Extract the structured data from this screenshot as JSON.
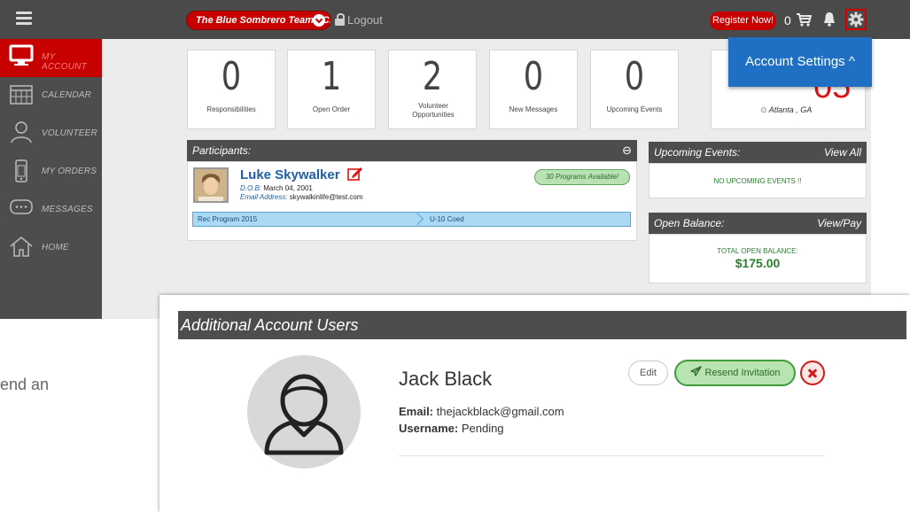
{
  "topbar": {
    "team_select": "The Blue Sombrero Team - C...",
    "logout": "Logout",
    "register": "Register Now!",
    "cart_count": "0",
    "account_settings": "Account Settings ^"
  },
  "sidebar": {
    "items": [
      {
        "label": "MY ACCOUNT",
        "icon": "monitor-icon",
        "active": true
      },
      {
        "label": "CALENDAR",
        "icon": "calendar-icon"
      },
      {
        "label": "VOLUNTEER",
        "icon": "person-icon"
      },
      {
        "label": "MY ORDERS",
        "icon": "phone-icon"
      },
      {
        "label": "MESSAGES",
        "icon": "chat-icon"
      },
      {
        "label": "HOME",
        "icon": "home-icon"
      }
    ]
  },
  "stats": [
    {
      "value": "0",
      "caption": "Responsibilities"
    },
    {
      "value": "1",
      "caption": "Open Order"
    },
    {
      "value": "2",
      "caption": "Volunteer Opportunities"
    },
    {
      "value": "0",
      "caption": "New Messages"
    },
    {
      "value": "0",
      "caption": "Upcoming Events"
    }
  ],
  "weather": {
    "temp_partial": "05",
    "location": "Atlanta , GA"
  },
  "participants": {
    "title": "Participants:",
    "name": "Luke Skywalker",
    "dob_label": "D.O.B:",
    "dob": "March 04, 2001",
    "email_label": "Email Address:",
    "email": "skywalkinlife@test.com",
    "programs_badge": "30 Programs Available!",
    "program": "Rec Program 2015",
    "division": "U-10 Coed"
  },
  "upcoming_events": {
    "title": "Upcoming Events:",
    "action": "View All",
    "empty": "NO UPCOMING EVENTS !!"
  },
  "open_balance": {
    "title": "Open Balance:",
    "action": "View/Pay",
    "label": "TOTAL OPEN BALANCE:",
    "amount": "$175.00"
  },
  "additional_users": {
    "title": "Additional Account Users",
    "name": "Jack Black",
    "email_label": "Email:",
    "email": "thejackblack@gmail.com",
    "username_label": "Username:",
    "username": "Pending",
    "edit": "Edit",
    "resend": "Resend Invitation"
  },
  "behind_text": "end an",
  "colors": {
    "brand_red": "#c70000",
    "accent_blue": "#1f6fc5",
    "success_green": "#2e7d32",
    "dark_header": "#4d4d4d"
  }
}
